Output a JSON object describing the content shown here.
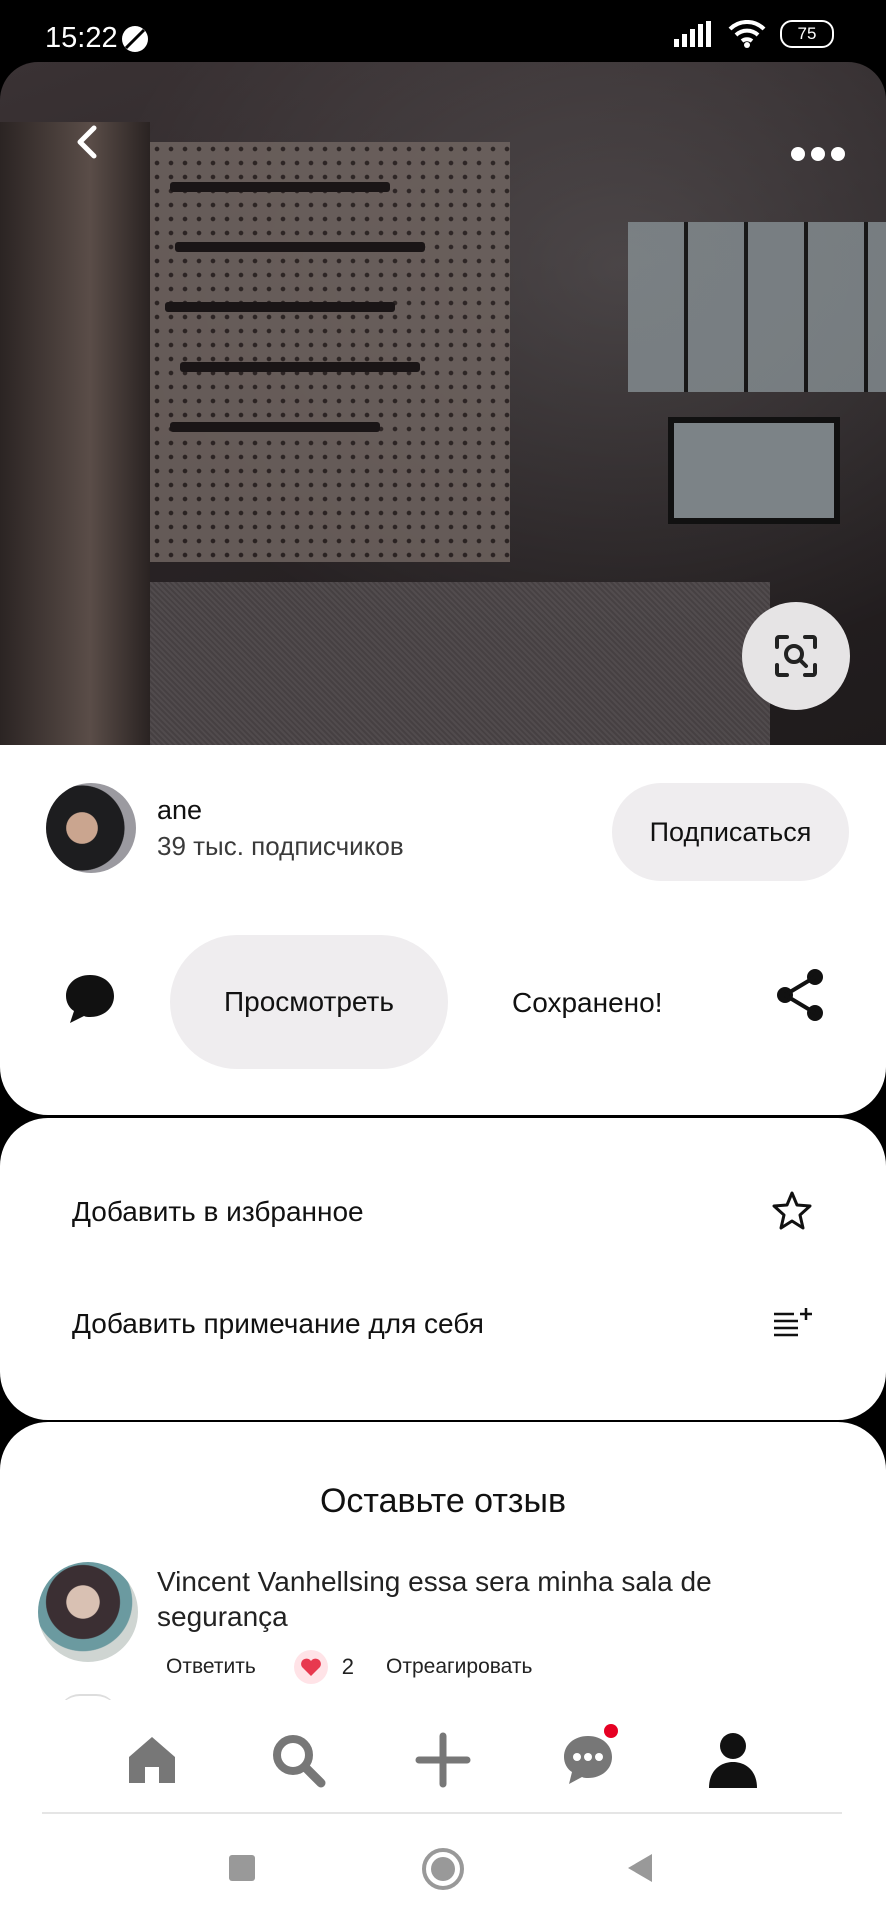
{
  "status_bar": {
    "time": "15:22",
    "battery": "75"
  },
  "pin": {
    "author": {
      "name": "ane",
      "followers": "39 тыс. подписчиков"
    },
    "subscribe_label": "Подписаться",
    "view_label": "Просмотреть",
    "saved_label": "Сохранено!"
  },
  "menu": {
    "items": [
      {
        "label": "Добавить в избранное",
        "icon": "star-icon"
      },
      {
        "label": "Добавить примечание для себя",
        "icon": "add-note-icon"
      }
    ]
  },
  "reviews": {
    "title": "Оставьте отзыв",
    "comments": [
      {
        "text": "Vincent Vanhellsing essa sera minha sala de segurança",
        "reply_label": "Ответить",
        "reaction_count": "2",
        "react_label": "Отреагировать"
      }
    ]
  },
  "bottom_nav": {
    "items": [
      {
        "icon": "home-icon"
      },
      {
        "icon": "search-icon"
      },
      {
        "icon": "plus-icon"
      },
      {
        "icon": "messages-icon",
        "badge": true
      },
      {
        "icon": "profile-icon",
        "active": true
      }
    ]
  },
  "colors": {
    "accent_badge": "#e60023",
    "chip_bg": "#efedef"
  }
}
